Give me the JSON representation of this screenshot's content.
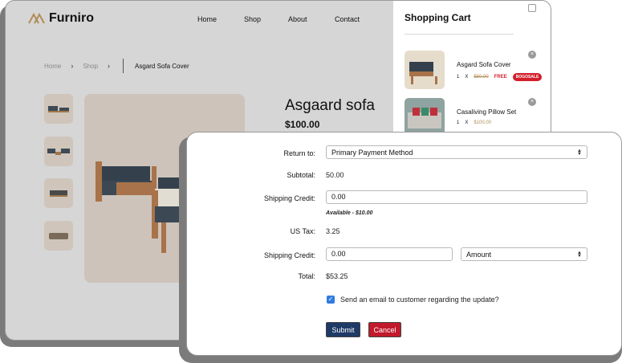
{
  "store": {
    "logo_text": "Furniro",
    "nav": [
      "Home",
      "Shop",
      "About",
      "Contact"
    ],
    "breadcrumb": {
      "home": "Home",
      "shop": "Shop",
      "current": "Asgard Sofa Cover"
    },
    "product_title": "Asgaard sofa",
    "product_price": "$100.00"
  },
  "cart": {
    "title": "Shopping Cart",
    "items": [
      {
        "name": "Asgard Sofa Cover",
        "qty": "1",
        "x": "X",
        "old_price": "$50.00",
        "free": "FREE",
        "badge": "BOGOSALE"
      },
      {
        "name": "Casaliving Pillow Set",
        "qty": "1",
        "x": "X",
        "price": "$100.00"
      }
    ]
  },
  "dialog": {
    "return_to_label": "Return to:",
    "return_to_value": "Primary Payment Method",
    "subtotal_label": "Subtotal:",
    "subtotal_value": "50.00",
    "shipping_credit_label": "Shipping Credit:",
    "shipping_credit_value": "0.00",
    "available_note": "Available - $10.00",
    "tax_label": "US Tax:",
    "tax_value": "3.25",
    "shipping_credit2_label": "Shipping Credit:",
    "shipping_credit2_value": "0.00",
    "amount_select": "Amount",
    "total_label": "Total:",
    "total_value": "$53.25",
    "email_checkbox_label": "Send an email to customer regarding the update?",
    "email_checked": true,
    "submit_label": "Submit",
    "cancel_label": "Cancel"
  },
  "colors": {
    "submit": "#1e3a66",
    "cancel": "#c01a2b",
    "checkbox": "#2f7be0",
    "sale_badge": "#d21f2b",
    "price_gold": "#b08d57"
  }
}
